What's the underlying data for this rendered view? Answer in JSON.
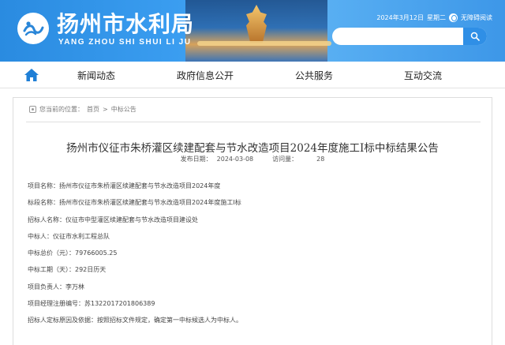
{
  "header": {
    "logo_text": "扬州市水利局",
    "logo_subtitle": "YANG ZHOU SHI SHUI LI JU",
    "date": "2024年3月12日",
    "weekday": "星期二",
    "accessibility_label": "无障碍阅读",
    "search": {
      "placeholder": "",
      "value": ""
    }
  },
  "nav": {
    "items": [
      {
        "label": "新闻动态"
      },
      {
        "label": "政府信息公开"
      },
      {
        "label": "公共服务"
      },
      {
        "label": "互动交流"
      }
    ]
  },
  "breadcrumb": {
    "prefix": "您当前的位置：",
    "home": "首页",
    "sep": ">",
    "current": "中标公告"
  },
  "article": {
    "title": "扬州市仪征市朱桥灌区续建配套与节水改造项目2024年度施工Ⅰ标中标结果公告",
    "publish_label": "发布日期：",
    "publish_date": "2024-03-08",
    "views_label": "访问量：",
    "views_count": "28",
    "fields": [
      "项目名称：扬州市仪征市朱桥灌区续建配套与节水改造项目2024年度",
      "标段名称：扬州市仪征市朱桥灌区续建配套与节水改造项目2024年度施工Ⅰ标",
      "招标人名称：仪征市中型灌区续建配套与节水改造项目建设处",
      "中标人：仪征市水利工程总队",
      "中标总价（元）：79766005.25",
      "中标工期（天）：292日历天",
      "项目负责人：李万林",
      "项目经理注册编号：苏1322017201806389",
      "招标人定标原因及依据：按照招标文件规定，确定第一中标候选人为中标人。"
    ]
  },
  "colors": {
    "banner": "#3a9df0",
    "search_button": "#2f8fe6",
    "nav_home": "#1f7fd6"
  }
}
